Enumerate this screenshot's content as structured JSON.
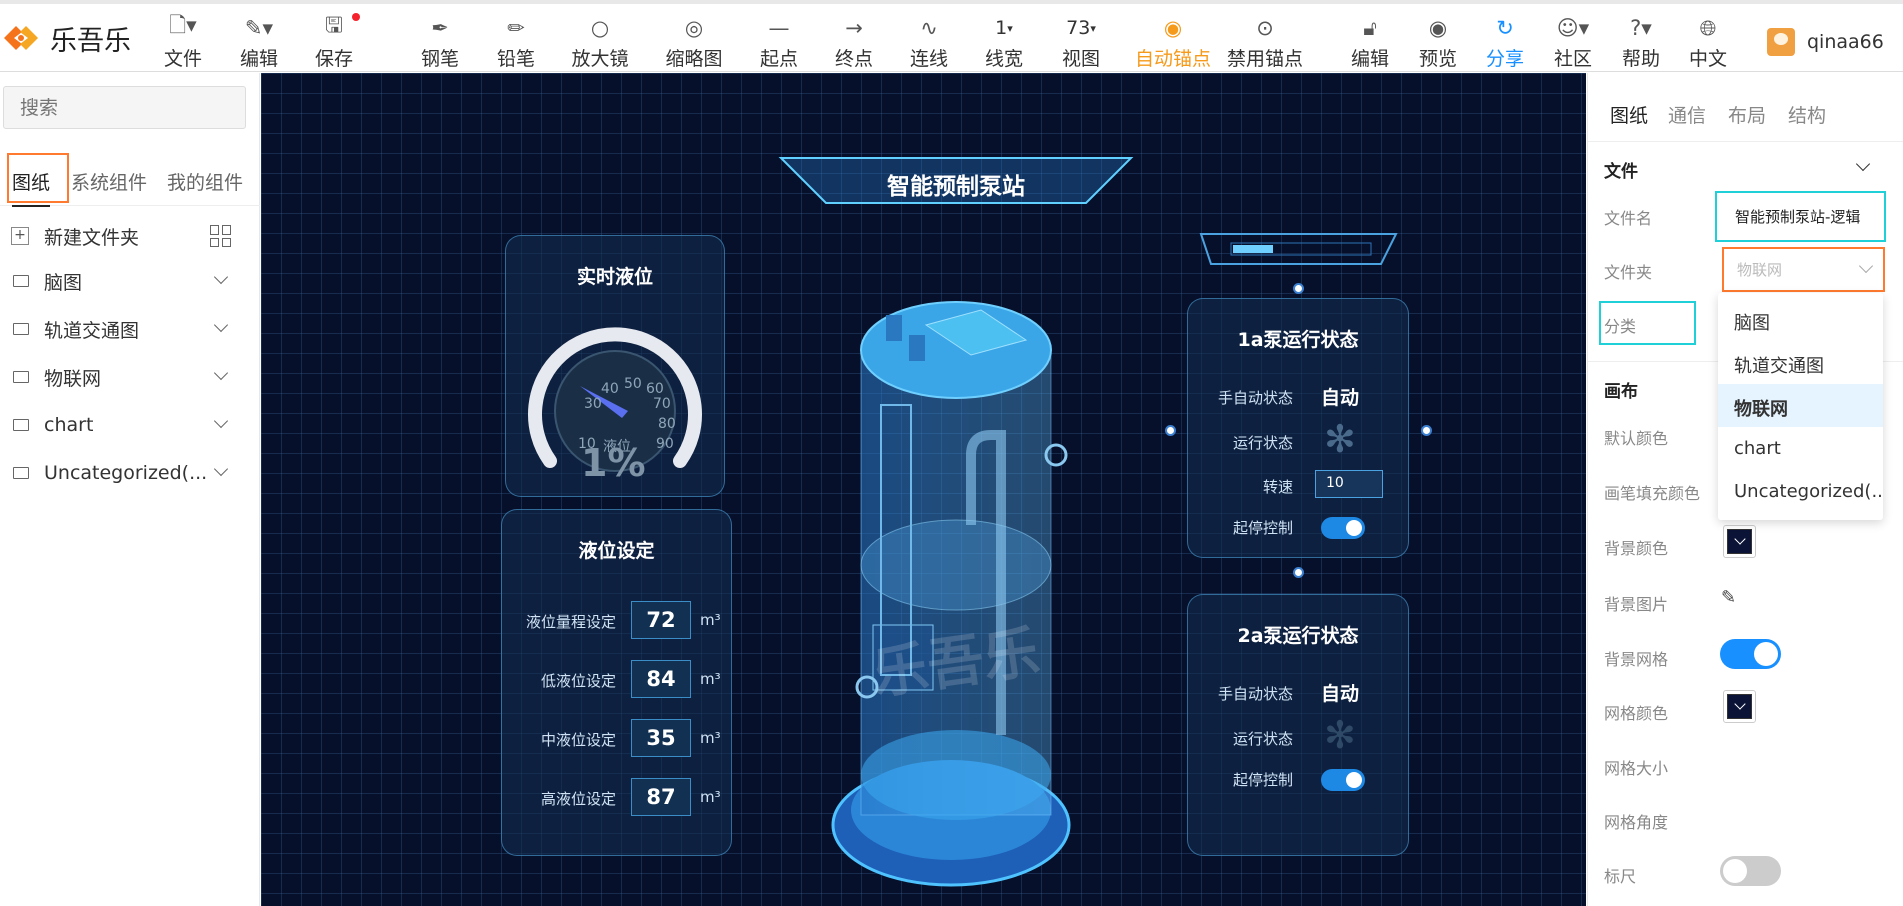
{
  "app": {
    "brand": "乐吾乐",
    "user": "qinaa66"
  },
  "toolbar": {
    "file": "文件",
    "edit": "编辑",
    "save": "保存",
    "pen": "钢笔",
    "pencil": "铅笔",
    "magnifier": "放大镜",
    "thumbnail": "缩略图",
    "start": "起点",
    "end": "终点",
    "line": "连线",
    "line_width_value": "1",
    "line_width": "线宽",
    "zoom_value": "73",
    "view": "视图",
    "auto_anchor": "自动锚点",
    "disable_anchor": "禁用锚点",
    "edit2": "编辑",
    "preview": "预览",
    "share": "分享",
    "community": "社区",
    "help": "帮助",
    "lang": "中文"
  },
  "left": {
    "search_placeholder": "搜索",
    "tabs": [
      "图纸",
      "系统组件",
      "我的组件"
    ],
    "new_folder": "新建文件夹",
    "folders": [
      "脑图",
      "轨道交通图",
      "物联网",
      "chart",
      "Uncategorized(..."
    ]
  },
  "canvas": {
    "title": "智能预制泵站",
    "level_panel": {
      "title": "实时液位",
      "gauge_value": "1%",
      "gauge_ticks": [
        "30",
        "40",
        "50",
        "60",
        "70",
        "80",
        "90",
        "10",
        "液位"
      ]
    },
    "setting_panel": {
      "title": "液位设定",
      "rows": [
        {
          "label": "液位量程设定",
          "value": "72",
          "unit": "m³"
        },
        {
          "label": "低液位设定",
          "value": "84",
          "unit": "m³"
        },
        {
          "label": "中液位设定",
          "value": "35",
          "unit": "m³"
        },
        {
          "label": "高液位设定",
          "value": "87",
          "unit": "m³"
        }
      ]
    },
    "watermark": "乐吾乐",
    "pump1": {
      "title": "1a泵运行状态",
      "mode_label": "手自动状态",
      "mode_value": "自动",
      "run_label": "运行状态",
      "speed_label": "转速",
      "speed_value": "10",
      "ctrl_label": "起停控制"
    },
    "pump2": {
      "title": "2a泵运行状态",
      "mode_label": "手自动状态",
      "mode_value": "自动",
      "run_label": "运行状态",
      "ctrl_label": "起停控制"
    }
  },
  "right": {
    "tabs": [
      "图纸",
      "通信",
      "布局",
      "结构"
    ],
    "file_section": "文件",
    "file_name_label": "文件名",
    "file_name_value": "智能预制泵站-逻辑",
    "folder_label": "文件夹",
    "folder_value": "物联网",
    "category_label": "分类",
    "canvas_section": "画布",
    "props": [
      "默认颜色",
      "画笔填充颜色",
      "背景颜色",
      "背景图片",
      "背景网格",
      "网格颜色",
      "网格大小",
      "网格角度",
      "标尺"
    ],
    "dropdown": [
      "脑图",
      "轨道交通图",
      "物联网",
      "chart",
      "Uncategorized(..."
    ],
    "dropdown_selected": "物联网",
    "grid_enabled": true,
    "ruler_enabled": false
  },
  "colors": {
    "accent": "#1890ff",
    "orange": "#f59a1b",
    "canvas_bg": "#07102a",
    "highlight_cyan": "#1fd0d8",
    "highlight_orange": "#ff7a2f"
  }
}
